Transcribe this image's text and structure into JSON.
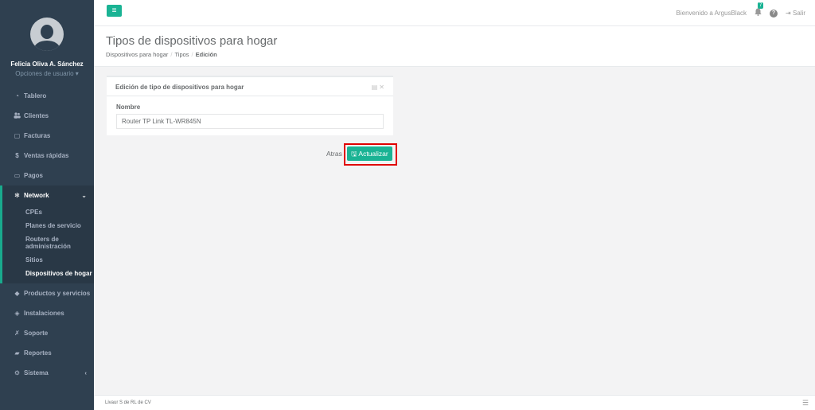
{
  "sidebar": {
    "user_name": "Felicia Oliva A. Sánchez",
    "user_options": "Opciones de usuario ▾",
    "items": [
      {
        "label": "Tablero",
        "icon": "dashboard-icon",
        "glyph": "◔"
      },
      {
        "label": "Clientes",
        "icon": "users-icon",
        "glyph": "👥"
      },
      {
        "label": "Facturas",
        "icon": "file-icon",
        "glyph": "▢"
      },
      {
        "label": "Ventas rápidas",
        "icon": "dollar-icon",
        "glyph": "$"
      },
      {
        "label": "Pagos",
        "icon": "money-icon",
        "glyph": "▭"
      }
    ],
    "network": {
      "label": "Network",
      "icon": "snowflake-icon",
      "glyph": "✻",
      "caret": "⌄",
      "sub_items": [
        "CPEs",
        "Planes de servicio",
        "Routers de administración",
        "Sitios",
        "Dispositivos de hogar"
      ]
    },
    "items_after": [
      {
        "label": "Productos y servicios",
        "icon": "tag-icon",
        "glyph": "◆"
      },
      {
        "label": "Instalaciones",
        "icon": "diamond-icon",
        "glyph": "◈"
      },
      {
        "label": "Soporte",
        "icon": "wrench-icon",
        "glyph": "✗"
      },
      {
        "label": "Reportes",
        "icon": "book-icon",
        "glyph": "▰"
      },
      {
        "label": "Sistema",
        "icon": "gears-icon",
        "glyph": "⚙",
        "caret": "‹"
      }
    ]
  },
  "topbar": {
    "menu_glyph": "≡",
    "welcome": "Bienvenido a ArgusBlack",
    "notification_count": "7",
    "help_glyph": "?",
    "logout_label": "Salir"
  },
  "heading": {
    "title": "Tipos de dispositivos para hogar",
    "breadcrumb": [
      "Dispositivos para hogar",
      "Tipos",
      "Edición"
    ]
  },
  "panel": {
    "title": "Edición de tipo de dispositivos para hogar",
    "field_label": "Nombre",
    "field_value": "Router TP Link TL-WR845N"
  },
  "actions": {
    "back_label": "Atras",
    "update_label": "Actualizar"
  },
  "footer": {
    "text": "Livaur S de RL de CV"
  },
  "colors": {
    "accent": "#1ab394",
    "sidebar_bg": "#2f4050",
    "highlight": "#e00000"
  }
}
